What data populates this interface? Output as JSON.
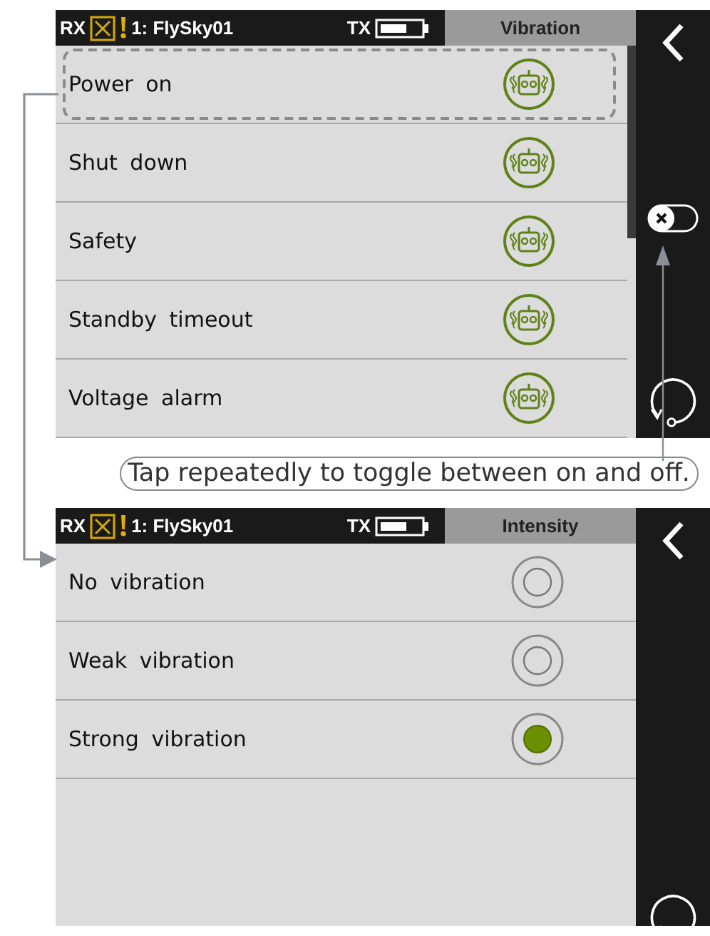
{
  "screens": [
    {
      "kind": "vibration-list",
      "status": {
        "rx": "RX",
        "receiver": "1: FlySky01",
        "tx": "TX"
      },
      "title": "Vibration",
      "toggle_on": false,
      "items": [
        {
          "label": "Power on",
          "highlighted": true
        },
        {
          "label": "Shut down",
          "highlighted": false
        },
        {
          "label": "Safety",
          "highlighted": false
        },
        {
          "label": "Standby timeout",
          "highlighted": false
        },
        {
          "label": "Voltage alarm",
          "highlighted": false
        }
      ]
    },
    {
      "kind": "radio-list",
      "status": {
        "rx": "RX",
        "receiver": "1: FlySky01",
        "tx": "TX"
      },
      "title": "Intensity",
      "items": [
        {
          "label": "No vibration",
          "selected": false
        },
        {
          "label": "Weak vibration",
          "selected": false
        },
        {
          "label": "Strong vibration",
          "selected": true
        }
      ]
    }
  ],
  "note": "Tap repeatedly to toggle between on and off."
}
